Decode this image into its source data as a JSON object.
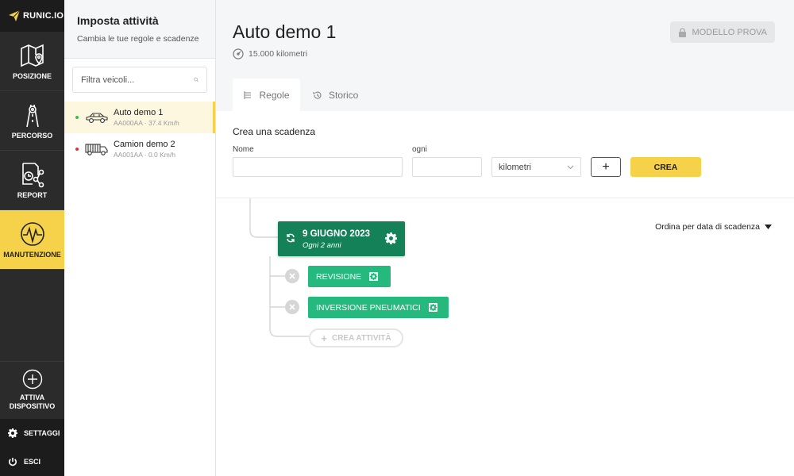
{
  "brand": {
    "name": "RUNIC.IO",
    "accent": "#f5d24a"
  },
  "nav": {
    "items": [
      {
        "label": "POSIZIONE",
        "icon": "map-icon"
      },
      {
        "label": "PERCORSO",
        "icon": "route-icon"
      },
      {
        "label": "REPORT",
        "icon": "report-icon"
      },
      {
        "label": "MANUTENZIONE",
        "icon": "maintenance-icon"
      }
    ],
    "activate_line1": "ATTIVA",
    "activate_line2": "DISPOSITIVO",
    "settings": "SETTAGGI",
    "logout": "ESCI"
  },
  "sidebar": {
    "title": "Imposta attività",
    "subtitle": "Cambia le tue regole e scadenze",
    "search_placeholder": "Filtra veicoli...",
    "vehicles": [
      {
        "name": "Auto demo 1",
        "meta": "AA000AA · 37.4 Km/h",
        "status_color": "#3fbf3f"
      },
      {
        "name": "Camion demo 2",
        "meta": "AA001AA · 0.0 Km/h",
        "status_color": "#e03030"
      }
    ]
  },
  "main": {
    "title": "Auto demo 1",
    "odometer": "15.000 kilometri",
    "demo_button": "MODELLO PROVA",
    "tabs": [
      {
        "label": "Regole"
      },
      {
        "label": "Storico"
      }
    ],
    "form": {
      "heading": "Crea una scadenza",
      "name_label": "Nome",
      "every_label": "ogni",
      "unit_value": "kilometri",
      "plus": "+",
      "create": "CREA"
    },
    "sort_label": "Ordina per data di scadenza",
    "deadline": {
      "date": "9 GIUGNO 2023",
      "every": "Ogni 2 anni",
      "color": "#158158"
    },
    "tasks": [
      {
        "label": "REVISIONE"
      },
      {
        "label": "INVERSIONE PNEUMATICI"
      }
    ],
    "add_task": "CREA ATTIVITÀ",
    "task_color": "#25b97d"
  }
}
